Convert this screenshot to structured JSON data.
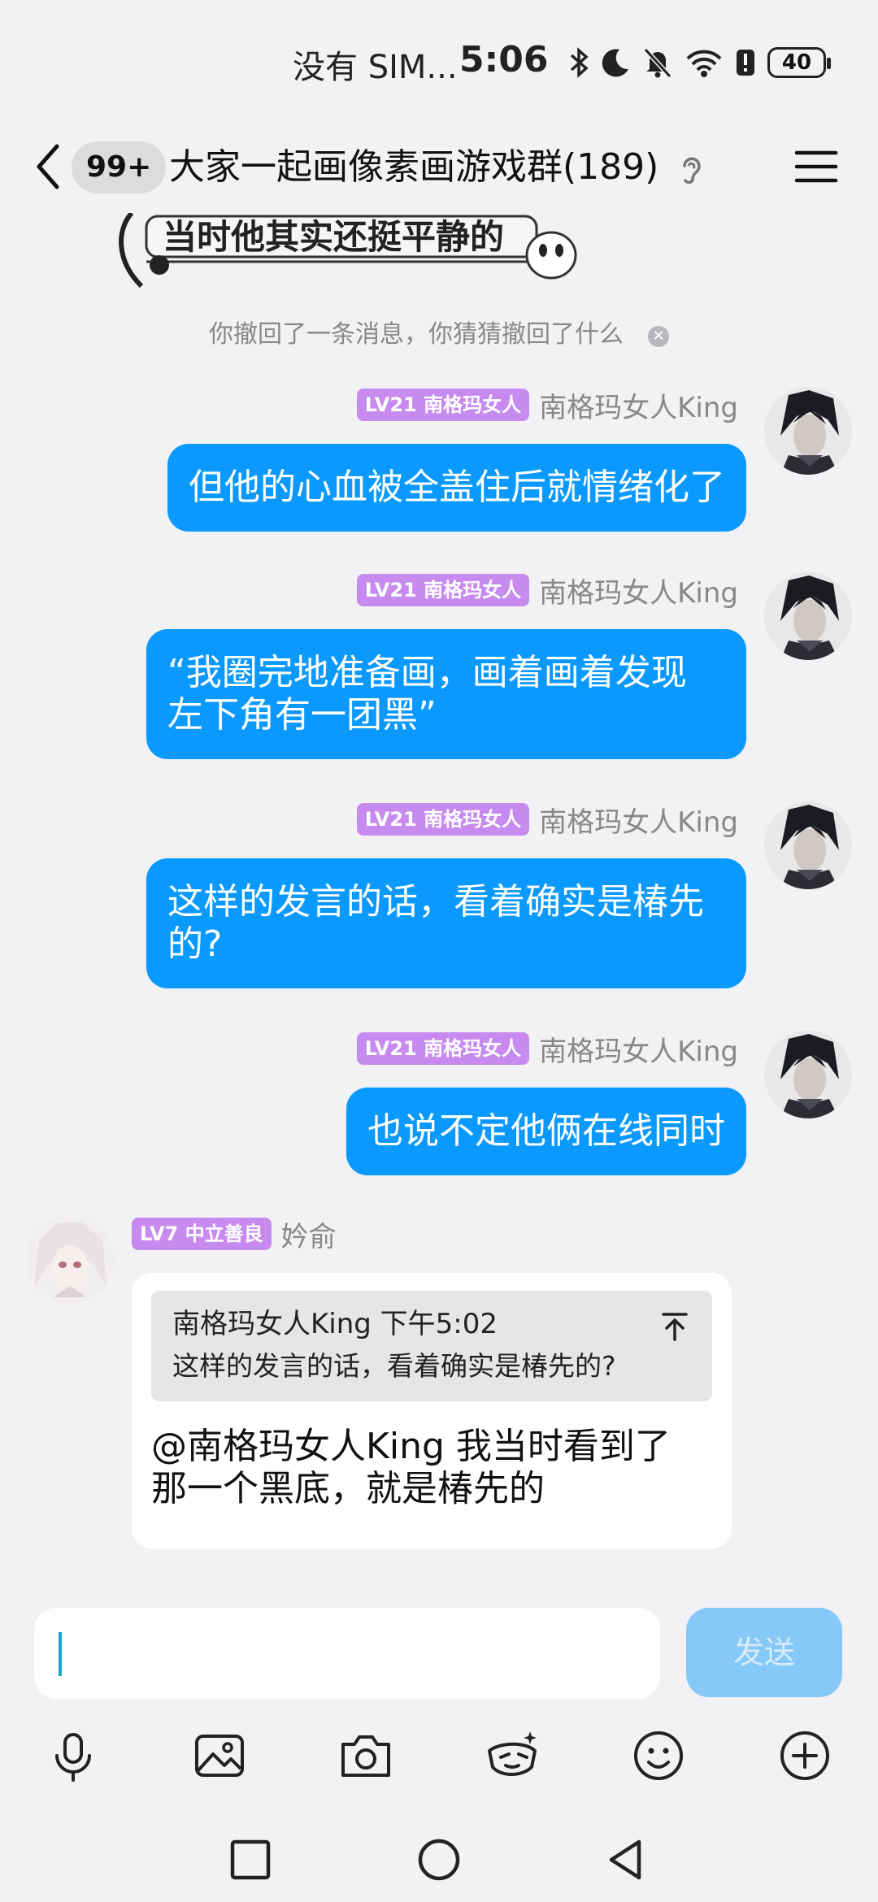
{
  "status_bar": {
    "carrier": "没有 SIM...",
    "time": "5:06",
    "battery": "40",
    "icons": [
      "bluetooth-icon",
      "moon-icon",
      "mute-bell-icon",
      "wifi-icon",
      "alert-icon",
      "battery-icon"
    ]
  },
  "header": {
    "unread_badge": "99+",
    "title": "大家一起画像素画游戏群(189)"
  },
  "sticker": {
    "text": "当时他其实还挺平静的"
  },
  "recall_notice": "你撤回了一条消息，你猜猜撤回了什么",
  "messages": [
    {
      "level": "LV21 南格玛女人",
      "sender": "南格玛女人King",
      "text": "但他的心血被全盖住后就情绪化了"
    },
    {
      "level": "LV21 南格玛女人",
      "sender": "南格玛女人King",
      "lines": [
        "“我圈完地准备画，画着画着发现",
        "左下角有一团黑”"
      ]
    },
    {
      "level": "LV21 南格玛女人",
      "sender": "南格玛女人King",
      "lines": [
        "这样的发言的话，看着确实是椿先",
        "的?"
      ]
    },
    {
      "level": "LV21 南格玛女人",
      "sender": "南格玛女人King",
      "text": "也说不定他俩在线同时"
    }
  ],
  "incoming": {
    "level": "LV7 中立善良",
    "sender": "妗俞",
    "quote": {
      "meta": "南格玛女人King 下午5:02",
      "text": "这样的发言的话，看着确实是椿先的?"
    },
    "lines": [
      "@南格玛女人King 我当时看到了",
      "那一个黑底，就是椿先的"
    ]
  },
  "input": {
    "value": "",
    "send_label": "发送"
  },
  "toolbar": [
    "microphone-icon",
    "image-icon",
    "camera-icon",
    "hongbao-icon",
    "emoji-icon",
    "plus-icon"
  ],
  "colors": {
    "bubble_out": "#0a99ff",
    "level_tag": "#c78bf0",
    "send_disabled": "#86c8f7"
  }
}
